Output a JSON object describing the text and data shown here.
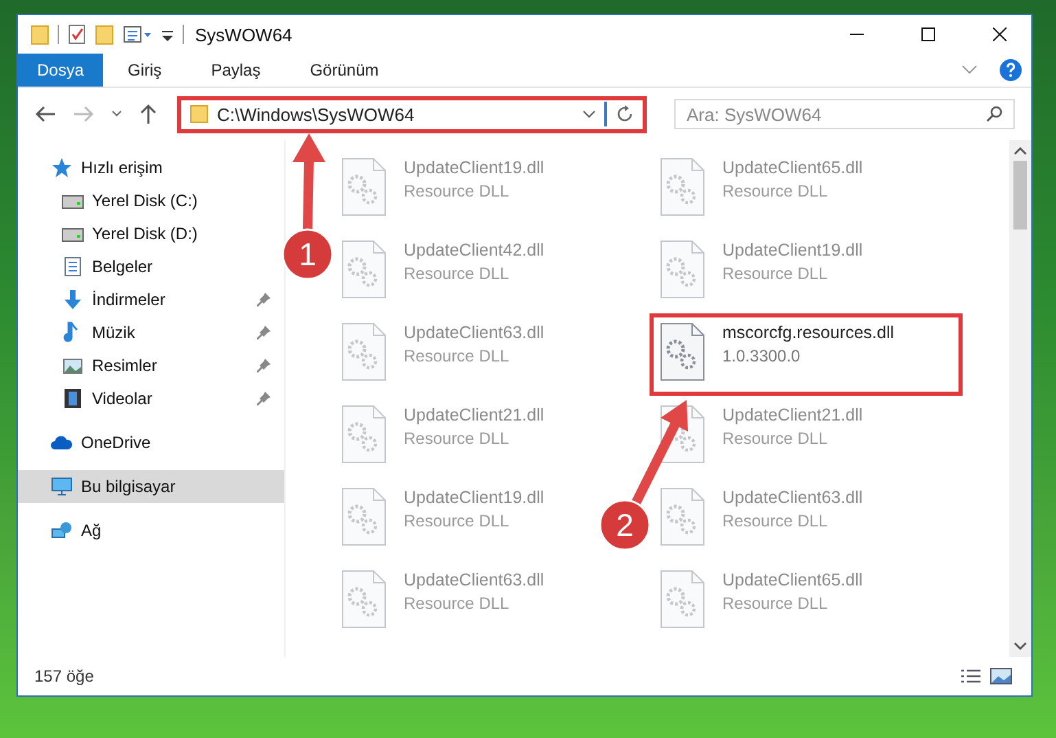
{
  "window": {
    "title": "SysWOW64"
  },
  "ribbon": {
    "tabs": [
      {
        "label": "Dosya",
        "selected": true
      },
      {
        "label": "Giriş",
        "selected": false
      },
      {
        "label": "Paylaş",
        "selected": false
      },
      {
        "label": "Görünüm",
        "selected": false
      }
    ]
  },
  "address": {
    "path": "C:\\Windows\\SysWOW64",
    "highlighted": true
  },
  "search": {
    "placeholder": "Ara: SysWOW64"
  },
  "sidebar": {
    "items": [
      {
        "label": "Hızlı erişim",
        "kind": "star",
        "selected": false,
        "children": [
          {
            "label": "Yerel Disk (C:)",
            "kind": "drive",
            "selected": false,
            "pinned": false
          },
          {
            "label": "Yerel Disk (D:)",
            "kind": "drive",
            "selected": false,
            "pinned": false
          },
          {
            "label": "Belgeler",
            "kind": "docs",
            "selected": false,
            "pinned": false
          },
          {
            "label": "İndirmeler",
            "kind": "download",
            "selected": false,
            "pinned": true
          },
          {
            "label": "Müzik",
            "kind": "music",
            "selected": false,
            "pinned": true
          },
          {
            "label": "Resimler",
            "kind": "pictures",
            "selected": false,
            "pinned": true
          },
          {
            "label": "Videolar",
            "kind": "video",
            "selected": false,
            "pinned": true
          }
        ]
      },
      {
        "label": "OneDrive",
        "kind": "cloud",
        "selected": false
      },
      {
        "label": "Bu bilgisayar",
        "kind": "pc",
        "selected": true
      },
      {
        "label": "Ağ",
        "kind": "network",
        "selected": false
      }
    ]
  },
  "files": [
    {
      "name": "UpdateClient19.dll",
      "detail": "Resource DLL",
      "blurred": true,
      "highlighted": false
    },
    {
      "name": "UpdateClient65.dll",
      "detail": "Resource DLL",
      "blurred": true,
      "highlighted": false
    },
    {
      "name": "UpdateClient42.dll",
      "detail": "Resource DLL",
      "blurred": true,
      "highlighted": false
    },
    {
      "name": "UpdateClient19.dll",
      "detail": "Resource DLL",
      "blurred": true,
      "highlighted": false
    },
    {
      "name": "UpdateClient63.dll",
      "detail": "Resource DLL",
      "blurred": true,
      "highlighted": false
    },
    {
      "name": "mscorcfg.resources.dll",
      "detail": "1.0.3300.0",
      "blurred": false,
      "highlighted": true
    },
    {
      "name": "UpdateClient21.dll",
      "detail": "Resource DLL",
      "blurred": true,
      "highlighted": false
    },
    {
      "name": "UpdateClient21.dll",
      "detail": "Resource DLL",
      "blurred": true,
      "highlighted": false
    },
    {
      "name": "UpdateClient19.dll",
      "detail": "Resource DLL",
      "blurred": true,
      "highlighted": false
    },
    {
      "name": "UpdateClient63.dll",
      "detail": "Resource DLL",
      "blurred": true,
      "highlighted": false
    },
    {
      "name": "UpdateClient63.dll",
      "detail": "Resource DLL",
      "blurred": true,
      "highlighted": false
    },
    {
      "name": "UpdateClient65.dll",
      "detail": "Resource DLL",
      "blurred": true,
      "highlighted": false
    }
  ],
  "callouts": [
    {
      "number": "1"
    },
    {
      "number": "2"
    }
  ],
  "status_bar": {
    "count": "157 öğe"
  }
}
